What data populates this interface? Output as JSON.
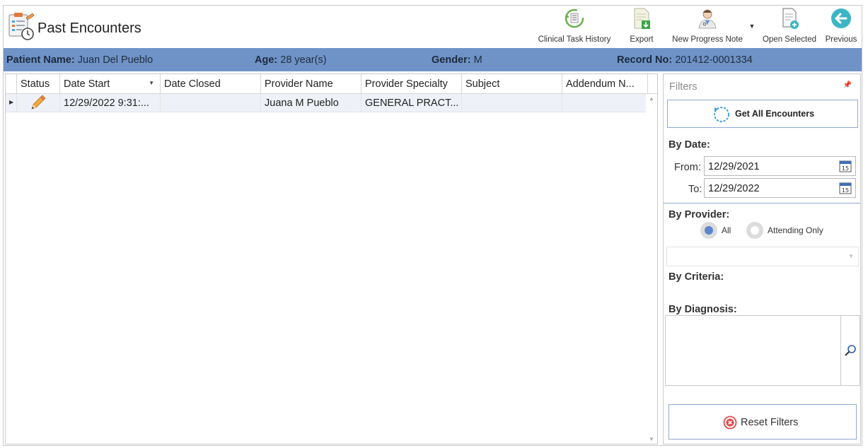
{
  "window": {
    "title": "Past Encounters"
  },
  "toolbar": {
    "clinical_task_history": "Clinical Task History",
    "export": "Export",
    "new_progress_note": "New Progress Note",
    "open_selected": "Open Selected",
    "previous": "Previous"
  },
  "patient": {
    "name_label": "Patient Name:",
    "name": "Juan Del Pueblo",
    "age_label": "Age:",
    "age": "28 year(s)",
    "gender_label": "Gender:",
    "gender": "M",
    "record_label": "Record No:",
    "record": "201412-0001334"
  },
  "grid": {
    "columns": [
      "Status",
      "Date Start",
      "Date Closed",
      "Provider Name",
      "Provider Specialty",
      "Subject",
      "Addendum N..."
    ],
    "rows": [
      {
        "status_icon": "pencil-icon",
        "date_start": "12/29/2022 9:31:...",
        "date_closed": "",
        "provider_name": "Juana M Pueblo",
        "provider_specialty": "GENERAL PRACT...",
        "subject": "",
        "addendum": ""
      }
    ]
  },
  "filters": {
    "title": "Filters",
    "get_all": "Get All Encounters",
    "by_date": "By Date:",
    "from_label": "From:",
    "from_value": "12/29/2021",
    "to_label": "To:",
    "to_value": "12/29/2022",
    "by_provider": "By Provider:",
    "radio_all": "All",
    "radio_attending": "Attending Only",
    "by_criteria": "By Criteria:",
    "by_diagnosis": "By Diagnosis:",
    "reset": "Reset Filters"
  },
  "colors": {
    "patient_bar": "#6f93c7",
    "accent_border": "#8faad4",
    "row_selected": "#eef2f8",
    "radio_selected": "#5b86cc",
    "reset_icon": "#e14b4b",
    "previous_icon": "#3cb6c6"
  }
}
